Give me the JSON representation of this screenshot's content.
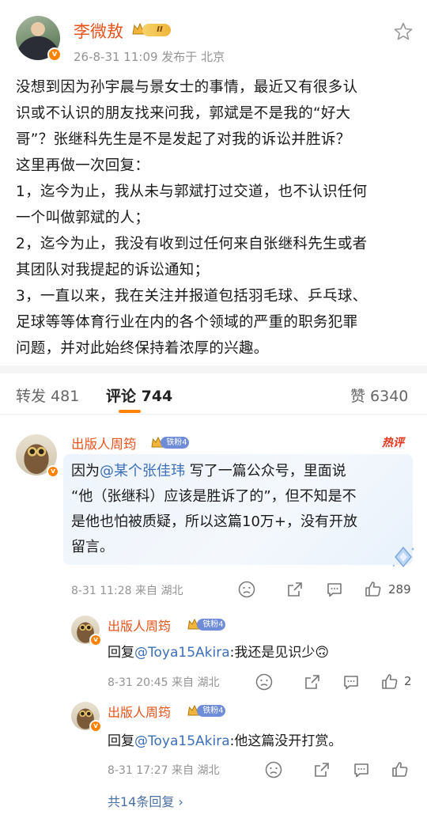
{
  "post": {
    "author": "李微敖",
    "level_badge": "II",
    "meta": "26-8-31 11:09  发布于 北京",
    "lines": [
      "没想到因为孙宇晨与景女士的事情，最近又有很多认",
      "识或不认识的朋友找来问我，郭斌是不是我的“好大",
      "哥”？张继科先生是不是发起了对我的诉讼并胜诉？",
      "这里再做一次回复：",
      "1，迄今为止，我从未与郭斌打过交道，也不认识任何",
      "一个叫做郭斌的人；",
      "2，迄今为止，我没有收到过任何来自张继科先生或者",
      "其团队对我提起的诉讼通知；",
      "3，一直以来，我在关注并报道包括羽毛球、乒乓球、",
      "足球等等体育行业在内的各个领域的严重的职务犯罪",
      "问题，并对此始终保持着浓厚的兴趣。"
    ]
  },
  "tabs": {
    "repost": "转发 481",
    "comment": "评论 744",
    "like": "赞 6340"
  },
  "comment": {
    "author": "出版人周筠",
    "fan_badge": "铁粉4",
    "hot_tag": "热评",
    "line1_pre": "因为",
    "line1_mention": "@某个张佳玮",
    "line1_post": " 写了一篇公众号，里面说",
    "line2": "“他（张继科）应该是胜诉了的”，但不知是不",
    "line3": "是他也怕被质疑，所以这篇10万+，没有开放",
    "line4": "留言。",
    "meta": "8-31 11:28  来自 湖北",
    "likes": "289"
  },
  "replies": [
    {
      "author": "出版人周筠",
      "fan_badge": "铁粉4",
      "prefix": "回复",
      "mention": "@Toya15Akira",
      "text": ":我还是见识少",
      "emoji": "🙃",
      "meta": "8-31 20:45  来自 湖北",
      "likes": "2"
    },
    {
      "author": "出版人周筠",
      "fan_badge": "铁粉4",
      "prefix": "回复",
      "mention": "@Toya15Akira",
      "text": ":他这篇没开打赏。",
      "emoji": "",
      "meta": "8-31 17:27  来自 湖北",
      "likes": ""
    }
  ],
  "more_replies": "共14条回复 ›",
  "icons": {
    "star": "star-icon",
    "dislike": "dislike-face-icon",
    "share": "share-icon",
    "comment": "comment-bubble-icon",
    "like": "thumbs-up-icon"
  },
  "colors": {
    "accent": "#ff8200",
    "name": "#e8531b",
    "link": "#3d6fb8"
  }
}
